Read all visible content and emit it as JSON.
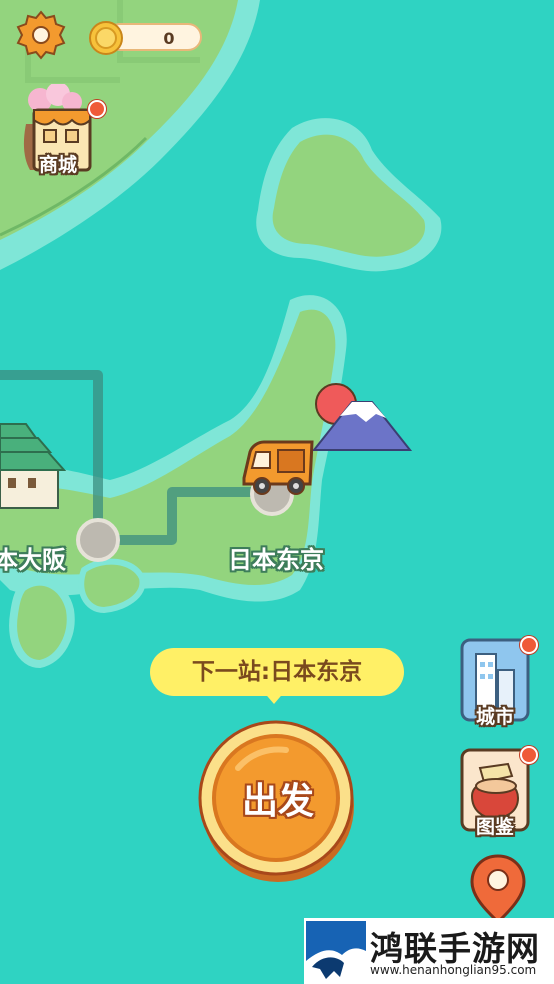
{
  "topbar": {
    "coins": "0",
    "settings_icon": "gear-icon",
    "coin_icon": "coin-icon"
  },
  "shop": {
    "label": "商城",
    "icon": "shop-building-icon"
  },
  "cities": {
    "osaka": "本大阪",
    "tokyo": "日本东京"
  },
  "next_stop": "下一站:日本东京",
  "go_button": "出发",
  "side_menu": {
    "city": {
      "label": "城市",
      "icon": "city-buildings-icon"
    },
    "guide": {
      "label": "图鉴",
      "icon": "food-jar-icon"
    },
    "location_icon": "map-pin-icon"
  },
  "watermark": {
    "title": "鸿联手游网",
    "url": "www.henanhonglian95.com"
  },
  "colors": {
    "sea": "#2fd3c2",
    "shallow": "#7fe6d7",
    "land": "#93d47e",
    "land_edge": "#6fb866",
    "route": "#3b8e80",
    "accent": "#f39a2e",
    "badge": "#ef5a38"
  }
}
